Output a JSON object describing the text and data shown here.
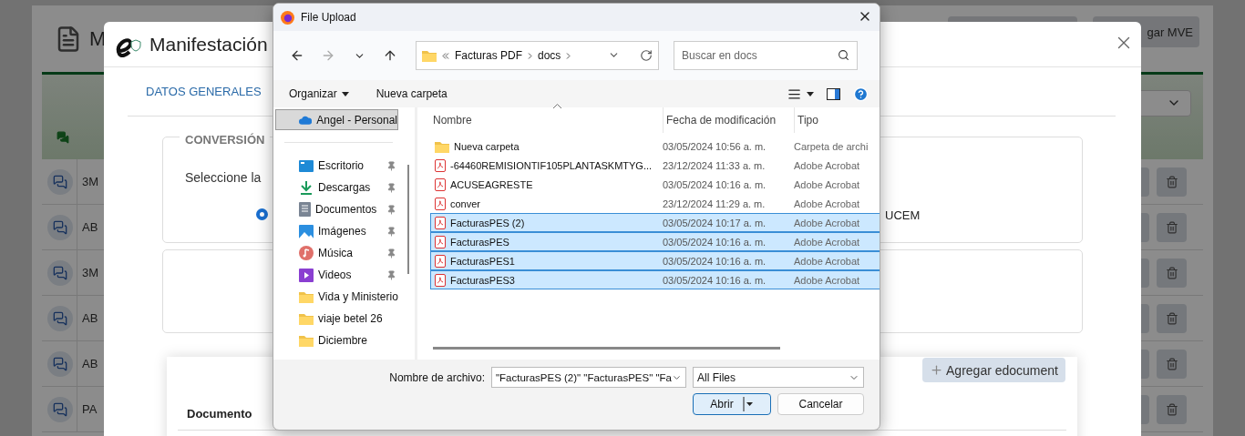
{
  "background_page": {
    "title": "M",
    "action_buttons": [
      {
        "label": "gar MVE"
      }
    ],
    "rows": [
      {
        "name": "3M"
      },
      {
        "name": "AB"
      },
      {
        "name": "3M"
      },
      {
        "name": "AB"
      },
      {
        "name": "AB"
      },
      {
        "name": "PA"
      }
    ]
  },
  "modal": {
    "title": "Manifestación",
    "tabs": [
      {
        "label": "DATOS GENERALES"
      }
    ],
    "conversion": {
      "legend": "CONVERSIÓN",
      "prompt": "Seleccione la",
      "radio": {
        "selected": true
      },
      "option_label": "UCEM"
    },
    "documents": {
      "add_button": "Agregar edocument",
      "columns": [
        "Documento"
      ]
    }
  },
  "file_dialog": {
    "title": "File Upload",
    "breadcrumb": [
      "Facturas PDF",
      "docs"
    ],
    "search": {
      "placeholder": "Buscar en docs"
    },
    "toolbar": [
      "Organizar",
      "Nueva carpeta"
    ],
    "nav": [
      {
        "label": "Angel - Personal",
        "kind": "cloud",
        "selected": true,
        "pinned": false
      },
      {
        "label": "Escritorio",
        "kind": "desktop",
        "selected": false,
        "pinned": true
      },
      {
        "label": "Descargas",
        "kind": "download",
        "selected": false,
        "pinned": true
      },
      {
        "label": "Documentos",
        "kind": "document",
        "selected": false,
        "pinned": true
      },
      {
        "label": "Imágenes",
        "kind": "image",
        "selected": false,
        "pinned": true
      },
      {
        "label": "Música",
        "kind": "music",
        "selected": false,
        "pinned": true
      },
      {
        "label": "Videos",
        "kind": "video",
        "selected": false,
        "pinned": true
      },
      {
        "label": "Vida y Ministerio",
        "kind": "folder",
        "selected": false,
        "pinned": false
      },
      {
        "label": "viaje betel 26",
        "kind": "folder",
        "selected": false,
        "pinned": false
      },
      {
        "label": "Diciembre",
        "kind": "folder",
        "selected": false,
        "pinned": false
      }
    ],
    "columns": [
      "Nombre",
      "Fecha de modificación",
      "Tipo"
    ],
    "files": [
      {
        "kind": "folder",
        "name": "Nueva carpeta",
        "date": "03/05/2024 10:56 a. m.",
        "type": "Carpeta de archi",
        "selected": false
      },
      {
        "kind": "pdf",
        "name": "-64460REMISIONTIF105PLANTASKMTYG...",
        "date": "23/12/2024 11:33 a. m.",
        "type": "Adobe Acrobat",
        "selected": false
      },
      {
        "kind": "pdf",
        "name": "ACUSEAGRESTE",
        "date": "03/05/2024 10:16 a. m.",
        "type": "Adobe Acrobat",
        "selected": false
      },
      {
        "kind": "pdf",
        "name": "conver",
        "date": "23/12/2024 11:29 a. m.",
        "type": "Adobe Acrobat",
        "selected": false
      },
      {
        "kind": "pdf",
        "name": "FacturasPES (2)",
        "date": "03/05/2024 10:17 a. m.",
        "type": "Adobe Acrobat",
        "selected": true
      },
      {
        "kind": "pdf",
        "name": "FacturasPES",
        "date": "03/05/2024 10:16 a. m.",
        "type": "Adobe Acrobat",
        "selected": true
      },
      {
        "kind": "pdf",
        "name": "FacturasPES1",
        "date": "03/05/2024 10:16 a. m.",
        "type": "Adobe Acrobat",
        "selected": true
      },
      {
        "kind": "pdf",
        "name": "FacturasPES3",
        "date": "03/05/2024 10:16 a. m.",
        "type": "Adobe Acrobat",
        "selected": true
      }
    ],
    "filename_label": "Nombre de archivo:",
    "filename_value": "\"FacturasPES (2)\" \"FacturasPES\" \"Fa",
    "filter": "All Files",
    "buttons": [
      "Abrir",
      "Cancelar"
    ]
  }
}
